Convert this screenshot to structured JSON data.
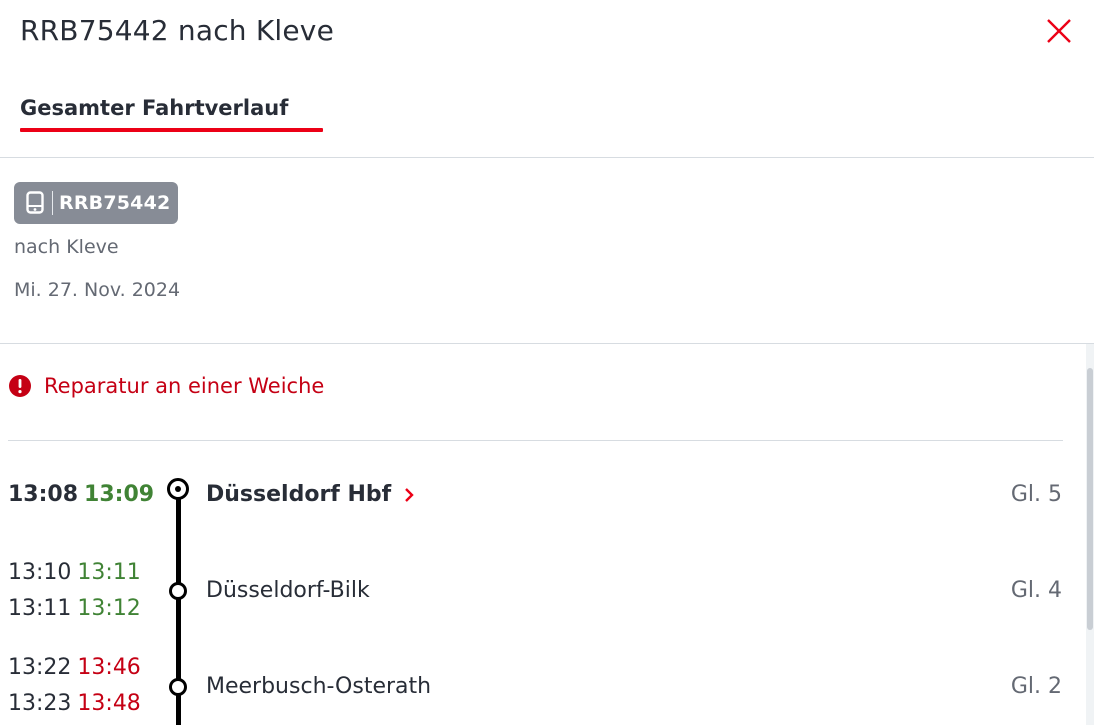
{
  "header": {
    "title": "RRB75442 nach Kleve",
    "tab_label": "Gesamter Fahrtverlauf"
  },
  "info": {
    "train_badge": "RRB75442",
    "destination": "nach Kleve",
    "date": "Mi. 27. Nov. 2024"
  },
  "alert": {
    "message": "Reparatur an einer Weiche",
    "icon": "exclamation-circle-icon"
  },
  "stops": [
    {
      "departure_planned": "13:08",
      "departure_actual": "13:09",
      "station": "Düsseldorf Hbf",
      "platform": "Gl. 5"
    },
    {
      "arrival_planned": "13:10",
      "arrival_actual": "13:11",
      "departure_planned": "13:11",
      "departure_actual": "13:12",
      "station": "Düsseldorf-Bilk",
      "platform": "Gl. 4"
    },
    {
      "arrival_planned": "13:22",
      "arrival_actual": "13:46",
      "departure_planned": "13:23",
      "departure_actual": "13:48",
      "station": "Meerbusch-Osterath",
      "platform": "Gl. 2"
    }
  ],
  "colors": {
    "accent": "#ec0016",
    "delay": "#c50014",
    "on_time": "#408335",
    "badge": "#878c96"
  }
}
